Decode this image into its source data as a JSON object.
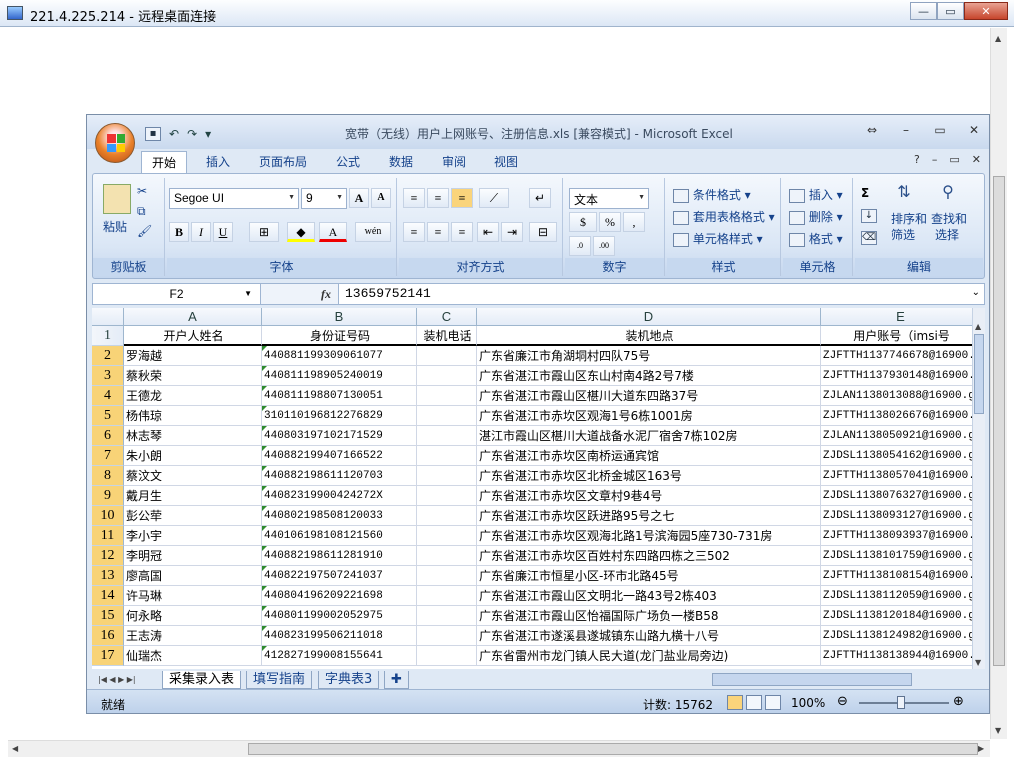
{
  "rdp": {
    "title": "221.4.225.214 - 远程桌面连接",
    "minimize": "—",
    "restore": "▭",
    "close": "✕"
  },
  "excel": {
    "caption": "宽带（无线）用户上网账号、注册信息.xls  [兼容模式] - Microsoft Excel",
    "tabs": [
      "开始",
      "插入",
      "页面布局",
      "公式",
      "数据",
      "审阅",
      "视图"
    ],
    "ribbon": {
      "clipboard": {
        "label": "剪贴板",
        "paste": "粘贴"
      },
      "font": {
        "label": "字体",
        "name": "Segoe UI",
        "size": "9",
        "bold": "B",
        "italic": "I",
        "underline": "U"
      },
      "alignment": {
        "label": "对齐方式"
      },
      "number": {
        "label": "数字",
        "format": "文本",
        "percent": "%",
        "comma": ","
      },
      "styles": {
        "label": "样式",
        "conditional": "条件格式",
        "table": "套用表格格式",
        "cell": "单元格样式"
      },
      "cells": {
        "label": "单元格",
        "insert": "插入",
        "delete": "删除",
        "format": "格式"
      },
      "editing": {
        "label": "编辑",
        "sort": "排序和",
        "sort2": "筛选",
        "find": "查找和",
        "find2": "选择",
        "sigma": "Σ"
      }
    },
    "formula_bar": {
      "name_box": "F2",
      "fx": "fx",
      "content": "13659752141"
    },
    "columns": [
      "A",
      "B",
      "C",
      "D",
      "E"
    ],
    "header_row": {
      "num": "1",
      "cells": [
        "开户人姓名",
        "身份证号码",
        "装机电话",
        "装机地点",
        "用户账号（imsi号"
      ]
    },
    "rows": [
      {
        "num": "2",
        "cells": [
          "罗海越",
          "440881199309061077",
          "",
          "广东省廉江市角湖垌村四队75号",
          "ZJFTTH1137746678@16900."
        ]
      },
      {
        "num": "3",
        "cells": [
          "蔡秋荣",
          "440811198905240019",
          "",
          "广东省湛江市霞山区东山村南4路2号7楼",
          "ZJFTTH1137930148@16900."
        ]
      },
      {
        "num": "4",
        "cells": [
          "王德龙",
          "440811198807130051",
          "",
          "广东省湛江市霞山区椹川大道东四路37号",
          "ZJLAN1138013088@16900.g"
        ]
      },
      {
        "num": "5",
        "cells": [
          "杨伟琼",
          "310110196812276829",
          "",
          "广东省湛江市赤坎区观海1号6栋1001房",
          "ZJFTTH1138026676@16900."
        ]
      },
      {
        "num": "6",
        "cells": [
          "林志琴",
          "440803197102171529",
          "",
          "湛江市霞山区椹川大道战备水泥厂宿舍7栋102房",
          "ZJLAN1138050921@16900.g"
        ]
      },
      {
        "num": "7",
        "cells": [
          "朱小朗",
          "440882199407166522",
          "",
          "广东省湛江市赤坎区南桥运通宾馆",
          "ZJDSL1138054162@16900.g"
        ]
      },
      {
        "num": "8",
        "cells": [
          "蔡汶文",
          "440882198611120703",
          "",
          "广东省湛江市赤坎区北桥金城区163号",
          "ZJFTTH1138057041@16900."
        ]
      },
      {
        "num": "9",
        "cells": [
          "戴月生",
          "44082319900424272X",
          "",
          "广东省湛江市赤坎区文章村9巷4号",
          "ZJDSL1138076327@16900.g"
        ]
      },
      {
        "num": "10",
        "cells": [
          "彭公荦",
          "440802198508120033",
          "",
          "广东省湛江市赤坎区跃进路95号之七",
          "ZJDSL1138093127@16900.g"
        ]
      },
      {
        "num": "11",
        "cells": [
          "李小宇",
          "440106198108121560",
          "",
          "广东省湛江市赤坎区观海北路1号滨海园5座730-731房",
          "ZJFTTH1138093937@16900."
        ]
      },
      {
        "num": "12",
        "cells": [
          "李明冠",
          "440882198611281910",
          "",
          "广东省湛江市赤坎区百姓村东四路四栋之三502",
          "ZJDSL1138101759@16900.g"
        ]
      },
      {
        "num": "13",
        "cells": [
          "廖高国",
          "440822197507241037",
          "",
          "广东省廉江市恒星小区-环市北路45号",
          "ZJFTTH1138108154@16900."
        ]
      },
      {
        "num": "14",
        "cells": [
          "许马琳",
          "440804196209221698",
          "",
          "广东省湛江市霞山区文明北一路43号2栋403",
          "ZJDSL1138112059@16900.g"
        ]
      },
      {
        "num": "15",
        "cells": [
          "何永略",
          "440801199002052975",
          "",
          "广东省湛江市霞山区怡福国际广场负一楼B58",
          "ZJDSL1138120184@16900.g"
        ]
      },
      {
        "num": "16",
        "cells": [
          "王志涛",
          "440823199506211018",
          "",
          "广东省湛江市遂溪县遂城镇东山路九横十八号",
          "ZJDSL1138124982@16900.g"
        ]
      },
      {
        "num": "17",
        "cells": [
          "仙瑞杰",
          "412827199008155641",
          "",
          "广东省雷州市龙门镇人民大道(龙门盐业局旁边)",
          "ZJFTTH1138138944@16900."
        ]
      }
    ],
    "sheet_tabs": [
      "采集录入表",
      "填写指南",
      "字典表3"
    ],
    "status": {
      "ready": "就绪",
      "count": "计数: 15762",
      "zoom": "100%"
    }
  }
}
